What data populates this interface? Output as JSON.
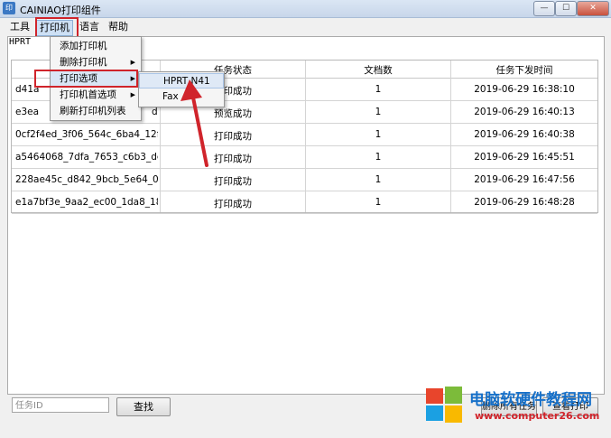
{
  "window": {
    "title": "CAINIAO打印组件",
    "controls": {
      "minimize": "—",
      "maximize": "☐",
      "close": "✕"
    }
  },
  "menubar": {
    "items": [
      "工具",
      "打印机",
      "语言",
      "帮助"
    ]
  },
  "tab": {
    "label": "HPRT"
  },
  "table": {
    "headers": [
      "",
      "任务状态",
      "文档数",
      "任务下发时间"
    ],
    "rows": [
      [
        "d41a",
        "打印成功",
        "1",
        "2019-06-29 16:38:10"
      ],
      [
        "e3ea",
        "预览成功",
        "1",
        "2019-06-29 16:40:13"
      ],
      [
        "0cf2f4ed_3f06_564c_6ba4_12f8...",
        "打印成功",
        "1",
        "2019-06-29 16:40:38"
      ],
      [
        "a5464068_7dfa_7653_c6b3_dec...",
        "打印成功",
        "1",
        "2019-06-29 16:45:51"
      ],
      [
        "228ae45c_d842_9bcb_5e64_03...",
        "打印成功",
        "1",
        "2019-06-29 16:47:56"
      ],
      [
        "e1a7bf3e_9aa2_ec00_1da8_180...",
        "打印成功",
        "1",
        "2019-06-29 16:48:28"
      ]
    ],
    "row1_tail": "d"
  },
  "printer_menu": {
    "items": [
      {
        "label": "添加打印机",
        "submenu": false
      },
      {
        "label": "删除打印机",
        "submenu": true
      },
      {
        "label": "打印选项",
        "submenu": true
      },
      {
        "label": "打印机首选项",
        "submenu": true
      },
      {
        "label": "刷新打印机列表",
        "submenu": false
      }
    ],
    "submenu_arrow": "▶"
  },
  "print_options_submenu": {
    "items": [
      "HPRT N41",
      "Fax"
    ]
  },
  "bottom": {
    "search_placeholder": "任务ID",
    "search_button": "查找",
    "right_button_1": "删除所有任务",
    "right_button_2": "查看打印"
  },
  "watermark": {
    "title": "电脑软硬件教程网",
    "url": "www.computer26.com"
  },
  "colors": {
    "highlight": "#d0242b",
    "accent": "#3b78c4"
  }
}
